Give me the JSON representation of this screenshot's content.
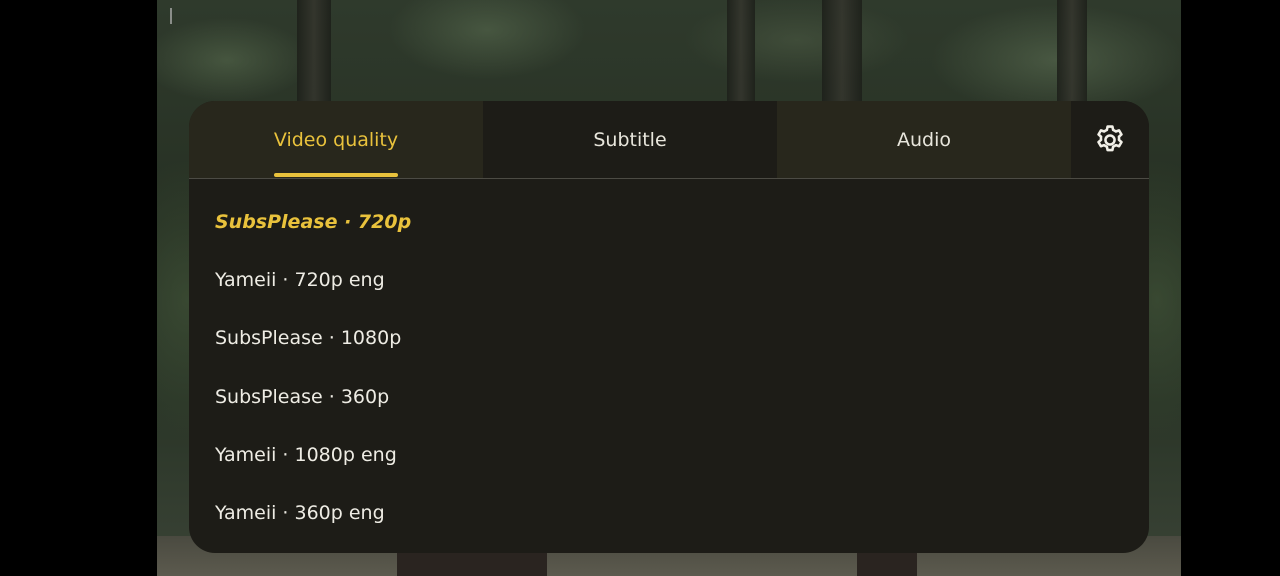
{
  "colors": {
    "accent": "#e9c23c",
    "panel_bg": "#1d1c17",
    "tab_tint_bg": "#28271c",
    "text": "#eeece4"
  },
  "tabs": [
    {
      "label": "Video quality",
      "active": true
    },
    {
      "label": "Subtitle",
      "active": false
    },
    {
      "label": "Audio",
      "active": false
    }
  ],
  "settings": {
    "icon": "gear-icon"
  },
  "quality_options": [
    {
      "label": "SubsPlease · 720p",
      "selected": true
    },
    {
      "label": "Yameii · 720p eng",
      "selected": false
    },
    {
      "label": "SubsPlease · 1080p",
      "selected": false
    },
    {
      "label": "SubsPlease · 360p",
      "selected": false
    },
    {
      "label": "Yameii · 1080p eng",
      "selected": false
    },
    {
      "label": "Yameii · 360p eng",
      "selected": false
    }
  ]
}
